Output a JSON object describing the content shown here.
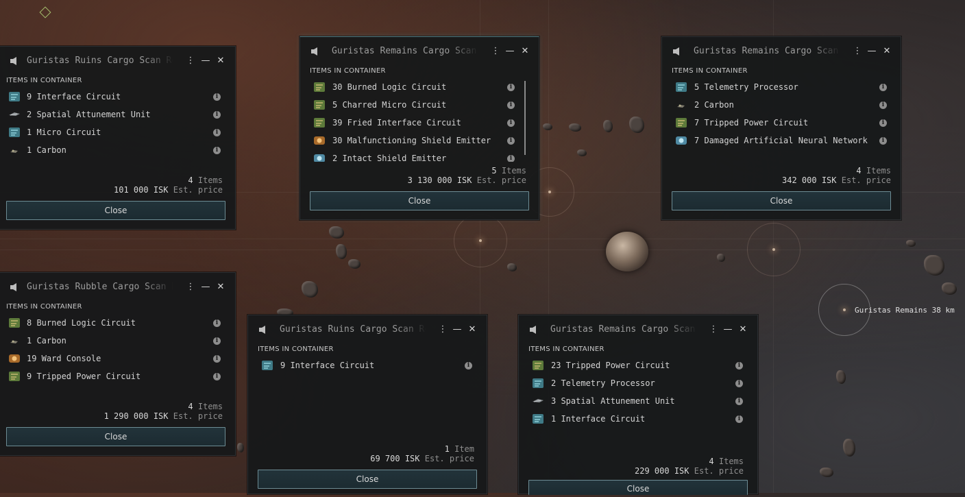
{
  "section_label": "ITEMS IN CONTAINER",
  "close_label": "Close",
  "items_word": "Items",
  "item_word": "Item",
  "isk_word": "ISK",
  "est_price_label": "Est. price",
  "overlay": {
    "target_label": "Guristas Remains 38 km"
  },
  "windows": [
    {
      "title": "Guristas Ruins Cargo Scan Result",
      "items": [
        "9 Interface Circuit",
        "2 Spatial Attunement Unit",
        "1 Micro Circuit",
        "1 Carbon"
      ],
      "item_icons": [
        "circuit-blue-icon",
        "wing-icon",
        "circuit-blue-icon",
        "ore-icon"
      ],
      "count": "4",
      "count_unit": "Items",
      "price": "101 000"
    },
    {
      "title": "Guristas Remains Cargo Scan Result",
      "items": [
        "30 Burned Logic Circuit",
        "5 Charred Micro Circuit",
        "39 Fried Interface Circuit",
        "30 Malfunctioning Shield Emitter",
        "2 Intact Shield Emitter"
      ],
      "item_icons": [
        "circuit-green-icon",
        "circuit-green-icon",
        "circuit-green-icon",
        "emitter-icon",
        "emitter-blue-icon"
      ],
      "count": "5",
      "count_unit": "Items",
      "price": "3 130 000"
    },
    {
      "title": "Guristas Remains Cargo Scan Result",
      "items": [
        "5 Telemetry Processor",
        "2 Carbon",
        "7 Tripped Power Circuit",
        "7 Damaged Artificial Neural Network"
      ],
      "item_icons": [
        "circuit-blue-icon",
        "ore-icon",
        "circuit-green-icon",
        "emitter-blue-icon"
      ],
      "count": "4",
      "count_unit": "Items",
      "price": "342 000"
    },
    {
      "title": "Guristas Rubble Cargo Scan Result",
      "items": [
        "8 Burned Logic Circuit",
        "1 Carbon",
        "19 Ward Console",
        "9 Tripped Power Circuit"
      ],
      "item_icons": [
        "circuit-green-icon",
        "ore-icon",
        "emitter-icon",
        "circuit-green-icon"
      ],
      "count": "4",
      "count_unit": "Items",
      "price": "1 290 000"
    },
    {
      "title": "Guristas Ruins Cargo Scan Result",
      "items": [
        "9 Interface Circuit"
      ],
      "item_icons": [
        "circuit-blue-icon"
      ],
      "count": "1",
      "count_unit": "Item",
      "price": "69 700"
    },
    {
      "title": "Guristas Remains Cargo Scan Result",
      "items": [
        "23 Tripped Power Circuit",
        "2 Telemetry Processor",
        "3 Spatial Attunement Unit",
        "1 Interface Circuit"
      ],
      "item_icons": [
        "circuit-green-icon",
        "circuit-blue-icon",
        "wing-icon",
        "circuit-blue-icon"
      ],
      "count": "4",
      "count_unit": "Items",
      "price": "229 000"
    }
  ]
}
